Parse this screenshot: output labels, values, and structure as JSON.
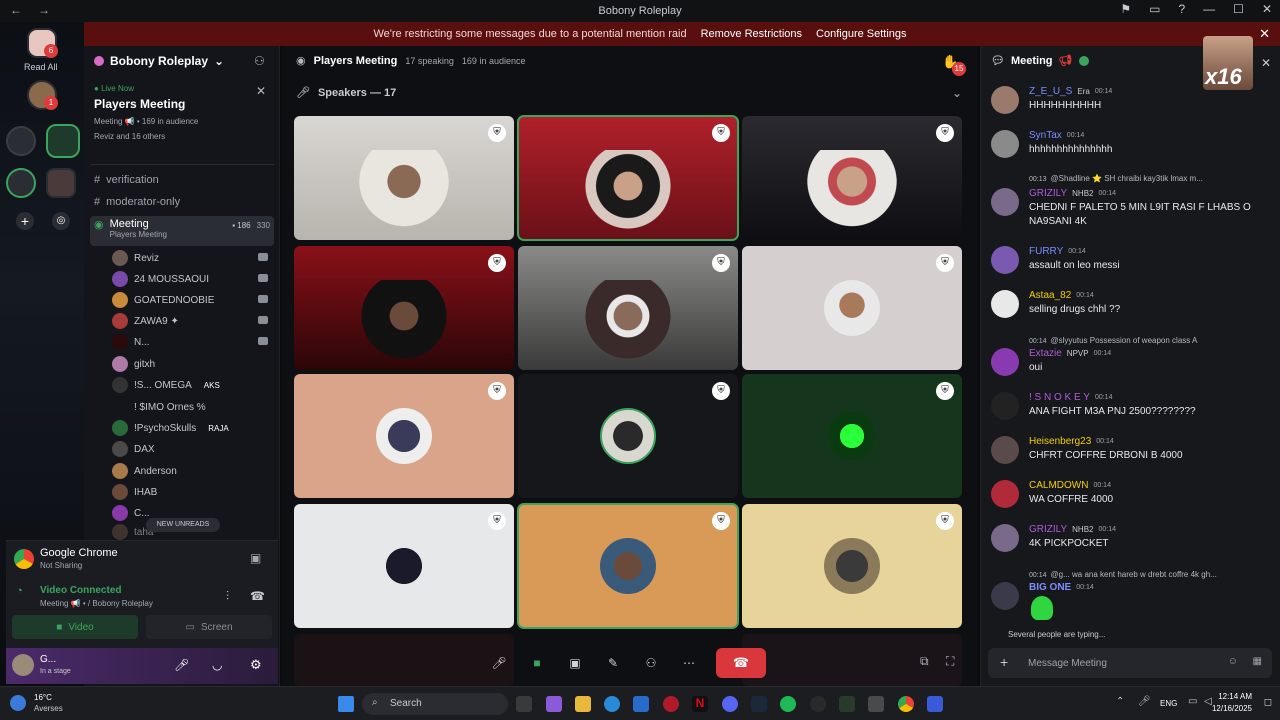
{
  "window": {
    "title": "Bobony Roleplay"
  },
  "banner": {
    "message": "We're restricting some messages due to a potential mention raid",
    "remove": "Remove Restrictions",
    "configure": "Configure Settings"
  },
  "rail": {
    "read_all": "Read All"
  },
  "sidebar": {
    "server_name": "Bobony Roleplay",
    "live_label": "Live Now",
    "live_title": "Players Meeting",
    "live_sub": "Meeting 📢 • 169 in audience",
    "live_people": "Reviz and 16 others",
    "channels": [
      {
        "name": "verification"
      },
      {
        "name": "moderator-only"
      }
    ],
    "selected_channel": {
      "name": "Meeting",
      "sub": "Players Meeting",
      "count1": "186",
      "count2": "330"
    },
    "members": [
      "Reviz",
      "24 MOUSSAOUI",
      "GOATEDNOOBIE",
      "ZAWA9 ✦",
      "N...",
      "gitxh",
      "!S... OMEGA",
      "! $IMO Ornes %",
      "!PsychoSkulls",
      "DAX",
      "Anderson",
      "IHAB",
      "C...",
      "taha"
    ],
    "member_tags": {
      "omega": "AKS",
      "psycho": "RAJA"
    },
    "new_unreads": "NEW UNREADS"
  },
  "voice_panel": {
    "app_name": "Google Chrome",
    "app_status": "Not Sharing",
    "status": "Video Connected",
    "channel": "Meeting 📢 • / Bobony Roleplay",
    "video_label": "Video",
    "screen_label": "Screen",
    "user_name": "G...",
    "user_status": "In a stage"
  },
  "stage": {
    "title": "Players Meeting",
    "speaking": "17 speaking",
    "audience": "169 in audience",
    "speakers_label": "Speakers — 17",
    "hand_badge": "15"
  },
  "chat": {
    "title": "Meeting",
    "messages": [
      {
        "user": "Z_E_U_S",
        "tag": "Era",
        "time": "00:14",
        "text": "HHHHHHHHHH",
        "color": "#7b8cff"
      },
      {
        "user": "SynTax",
        "time": "00:14",
        "text": "hhhhhhhhhhhhhhh",
        "color": "#7b8cff"
      },
      {
        "reply": "@Shadline ⭐ SH chraibi kay3tik lmax m...",
        "reply_time": "00:13",
        "user": "GRIZILY",
        "tag": "NHB2",
        "time": "00:14",
        "text": "CHEDNI F PALETO 5 MIN L9IT RASI F LHABS O",
        "text2": "NA9SANI 4K",
        "color": "#b05cd9"
      },
      {
        "user": "FURRY",
        "time": "00:14",
        "text": "assault on leo messi",
        "color": "#7b8cff"
      },
      {
        "user": "Astaa_82",
        "time": "00:14",
        "text": "selling drugs chhl ??",
        "color": "#f0d000"
      },
      {
        "reply": "@slyyutus Possession of weapon class A",
        "reply_time": "00:14",
        "user": "Extazie",
        "tag": "NPVP",
        "time": "00:14",
        "text": "oui",
        "color": "#b05cd9"
      },
      {
        "user": "! S N O K E Y",
        "time": "00:14",
        "text": "ANA FIGHT M3A PNJ 2500????????",
        "color": "#b05cd9"
      },
      {
        "user": "Heisenberg23",
        "time": "00:14",
        "text": "CHFRT COFFRE DRBONI B 4000",
        "color": "#f0d000"
      },
      {
        "user": "CALMDOWN",
        "time": "00:14",
        "text": "WA COFFRE 4000",
        "color": "#f0d000"
      },
      {
        "user": "GRIZILY",
        "tag": "NHB2",
        "time": "00:14",
        "text": "4K PICKPOCKET",
        "color": "#b05cd9"
      },
      {
        "reply": "@g... wa ana kent hareb w drebt coffre 4k gh...",
        "reply_time": "00:14",
        "user": "BIG ONE",
        "time": "00:14",
        "text": "",
        "color": "#7b8cff"
      }
    ],
    "typing": "Several people are typing...",
    "placeholder": "Message Meeting",
    "x16": "x16"
  },
  "taskbar": {
    "weather_temp": "16°C",
    "weather_desc": "Averses",
    "search": "Search",
    "lang": "ENG",
    "time": "12:14 AM",
    "date": "12/16/2025"
  },
  "colors": {
    "accent": "#3ba55d",
    "banner": "#5a0f0f",
    "hangup": "#da373c"
  }
}
